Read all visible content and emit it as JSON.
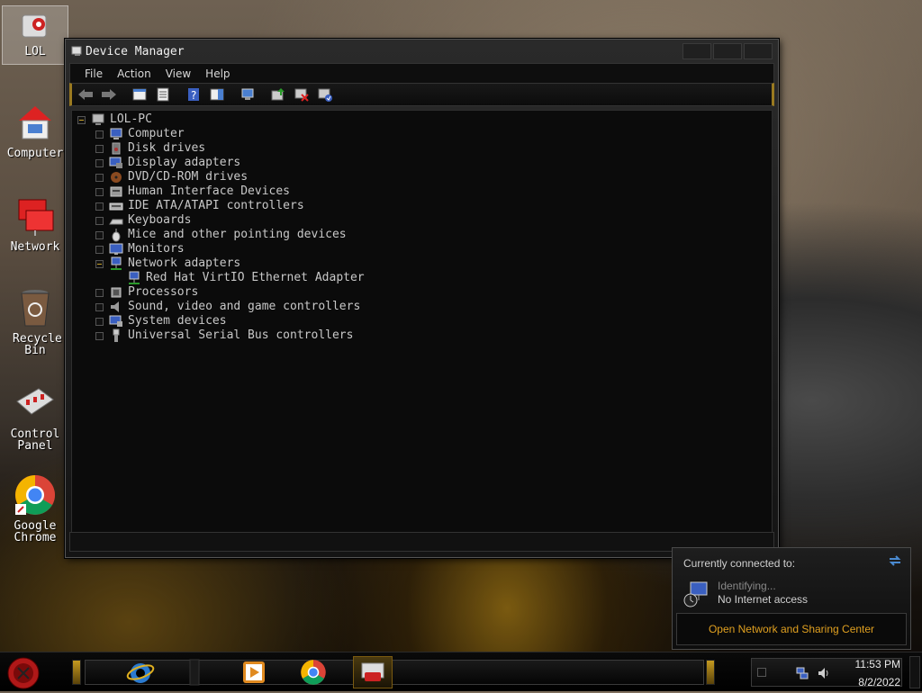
{
  "desktop": {
    "icons": [
      {
        "label": "LOL"
      },
      {
        "label": "Computer"
      },
      {
        "label": "Network"
      },
      {
        "label": "Recycle Bin"
      },
      {
        "label": "Control Panel"
      },
      {
        "label": "Google Chrome"
      }
    ]
  },
  "window": {
    "title": "Device Manager",
    "menu": [
      "File",
      "Action",
      "View",
      "Help"
    ],
    "tree": {
      "root": "LOL-PC",
      "categories": [
        "Computer",
        "Disk drives",
        "Display adapters",
        "DVD/CD-ROM drives",
        "Human Interface Devices",
        "IDE ATA/ATAPI controllers",
        "Keyboards",
        "Mice and other pointing devices",
        "Monitors",
        "Network adapters",
        "Processors",
        "Sound, video and game controllers",
        "System devices",
        "Universal Serial Bus controllers"
      ],
      "expanded_child": "Red Hat VirtIO Ethernet Adapter"
    }
  },
  "network_flyout": {
    "header": "Currently connected to:",
    "status_line1": "Identifying...",
    "status_line2": "No Internet access",
    "link": "Open Network and Sharing Center"
  },
  "taskbar": {
    "time": "11:53 PM",
    "date": "8/2/2022"
  },
  "colors": {
    "accent_gold": "#c9a227",
    "link_orange": "#e0a020",
    "window_bg": "#0b0b0b"
  }
}
